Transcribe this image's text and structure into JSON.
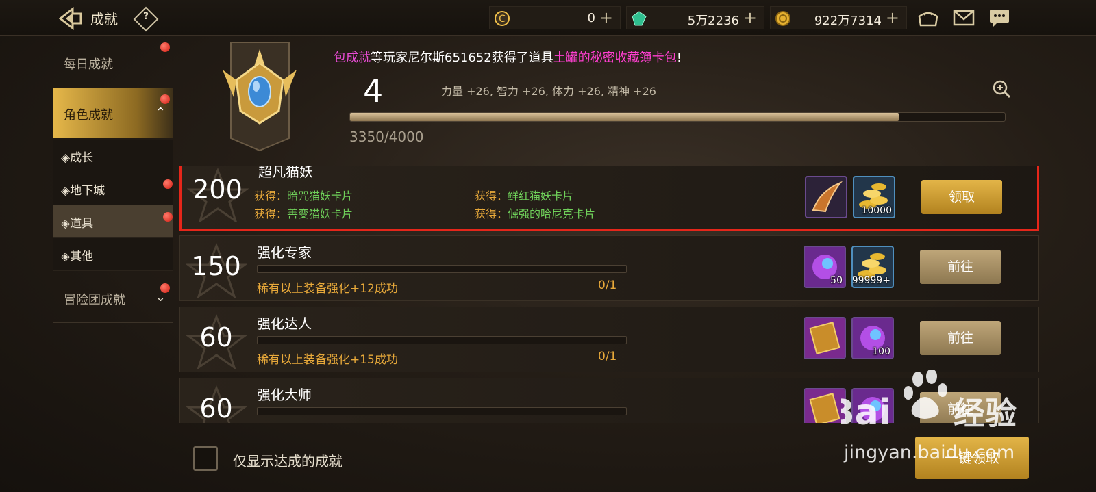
{
  "header": {
    "title": "成就",
    "help_glyph": "?"
  },
  "currencies": [
    {
      "name": "c-coin",
      "value": "0",
      "color": "#f2c14a"
    },
    {
      "name": "gem",
      "value": "5万2236",
      "color": "#36c79a"
    },
    {
      "name": "gold",
      "value": "922万7314",
      "color": "#e5b030"
    }
  ],
  "sidebar": {
    "items": [
      {
        "label": "每日成就"
      },
      {
        "label": "角色成就"
      },
      {
        "label": "◈成长"
      },
      {
        "label": "◈地下城"
      },
      {
        "label": "◈道具"
      },
      {
        "label": "◈其他"
      },
      {
        "label": "冒险团成就"
      }
    ],
    "chev_up": "⌃",
    "chev_down": "⌄"
  },
  "banner": {
    "ticker_prefix": "包成就",
    "ticker_mid": "等玩家尼尔斯651652获得了道具",
    "ticker_item": "土罐的秘密收藏簿卡包",
    "ticker_end": "!",
    "level": "4",
    "stats": "力量 +26, 智力 +26, 体力 +26, 精神 +26",
    "progress_text": "3350/4000",
    "progress_fraction": 0.8375
  },
  "achievements": [
    {
      "points": "200",
      "name": "超凡猫妖",
      "gain_label": "获得：",
      "gains": [
        "暗咒猫妖卡片",
        "鲜红猫妖卡片",
        "善变猫妖卡片",
        "倔强的哈尼克卡片"
      ],
      "rewards": [
        {
          "icon": "claw-item-icon",
          "count": ""
        },
        {
          "icon": "gold-coins-icon",
          "count": "10000"
        }
      ],
      "button": "领取"
    },
    {
      "points": "150",
      "name": "强化专家",
      "condition": "稀有以上装备强化+12成功",
      "progress": "0/1",
      "rewards": [
        {
          "icon": "orb-icon",
          "count": "50"
        },
        {
          "icon": "gold-coins-icon",
          "count": "99999+"
        }
      ],
      "button": "前往"
    },
    {
      "points": "60",
      "name": "强化达人",
      "condition": "稀有以上装备强化+15成功",
      "progress": "0/1",
      "rewards": [
        {
          "icon": "scroll-icon",
          "count": ""
        },
        {
          "icon": "orb-icon",
          "count": "100"
        }
      ],
      "button": "前往"
    },
    {
      "points": "60",
      "name": "强化大师",
      "condition": "",
      "progress": "",
      "rewards": [
        {
          "icon": "scroll-icon",
          "count": ""
        },
        {
          "icon": "orb-icon",
          "count": ""
        }
      ],
      "button": "前往"
    }
  ],
  "footer": {
    "checkbox_label": "仅显示达成的成就",
    "claim_all": "一键领取"
  },
  "watermark": {
    "brand": "Bai",
    "brand2": "经验",
    "url": "jingyan.baidu.com"
  }
}
